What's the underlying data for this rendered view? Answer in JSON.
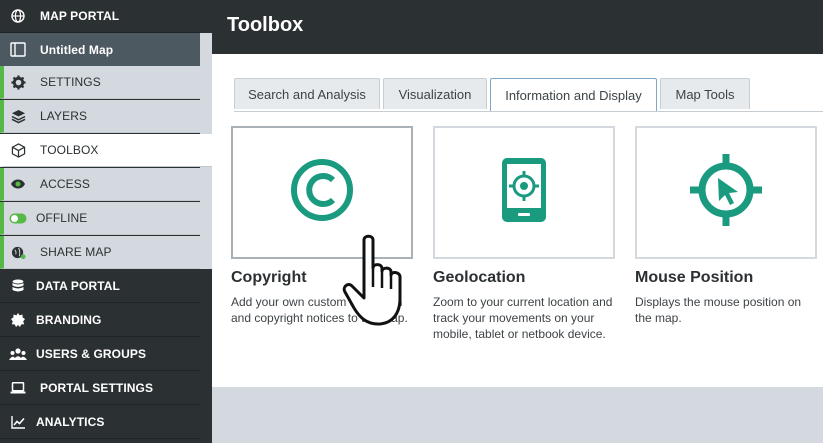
{
  "sidebar": {
    "items": [
      {
        "label": "MAP PORTAL",
        "icon": "globe-icon"
      },
      {
        "label": "Untitled Map",
        "icon": "map-book-icon"
      },
      {
        "label": "SETTINGS",
        "icon": "gear-icon"
      },
      {
        "label": "LAYERS",
        "icon": "layers-icon"
      },
      {
        "label": "TOOLBOX",
        "icon": "box-icon"
      },
      {
        "label": "ACCESS",
        "icon": "eye-icon"
      },
      {
        "label": "OFFLINE",
        "icon": "toggle-icon"
      },
      {
        "label": "SHARE MAP",
        "icon": "share-globe-icon"
      },
      {
        "label": "DATA PORTAL",
        "icon": "database-icon"
      },
      {
        "label": "BRANDING",
        "icon": "badge-icon"
      },
      {
        "label": "USERS & GROUPS",
        "icon": "users-icon"
      },
      {
        "label": "PORTAL SETTINGS",
        "icon": "laptop-icon"
      },
      {
        "label": "ANALYTICS",
        "icon": "chart-icon"
      }
    ]
  },
  "header": {
    "title": "Toolbox"
  },
  "tabs": [
    {
      "label": "Search and Analysis"
    },
    {
      "label": "Visualization"
    },
    {
      "label": "Information and Display"
    },
    {
      "label": "Map Tools"
    }
  ],
  "cards": [
    {
      "title": "Copyright",
      "desc": "Add your own custom attribution and copyright notices to the map.",
      "icon": "copyright-icon"
    },
    {
      "title": "Geolocation",
      "desc": "Zoom to your current location and track your movements on your mobile, tablet or netbook device.",
      "icon": "geolocation-tablet-icon"
    },
    {
      "title": "Mouse Position",
      "desc": "Displays the mouse position on the map.",
      "icon": "crosshair-cursor-icon"
    }
  ],
  "colors": {
    "accent": "#1a9b80",
    "sidebar": "#2b3033",
    "active_bar": "#56b947"
  }
}
